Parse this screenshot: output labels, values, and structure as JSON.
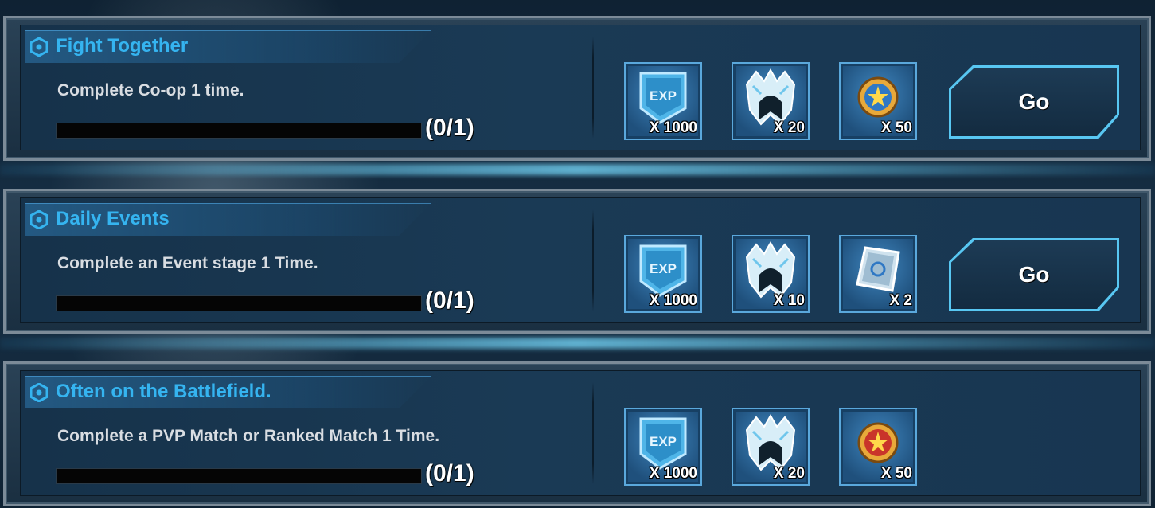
{
  "missions": [
    {
      "title": "Fight Together",
      "description": "Complete Co-op 1 time.",
      "progress_text": "(0/1)",
      "progress_fraction": 0,
      "rewards": [
        {
          "icon": "exp-card-icon",
          "qty": "X 1000"
        },
        {
          "icon": "helmet-icon",
          "qty": "X 20"
        },
        {
          "icon": "gold-medal-icon",
          "qty": "X 50"
        }
      ],
      "button": "Go"
    },
    {
      "title": "Daily Events",
      "description": "Complete an Event stage 1 Time.",
      "progress_text": "(0/1)",
      "progress_fraction": 0,
      "rewards": [
        {
          "icon": "exp-card-icon",
          "qty": "X 1000"
        },
        {
          "icon": "helmet-icon",
          "qty": "X 10"
        },
        {
          "icon": "crystal-chip-icon",
          "qty": "X 2"
        }
      ],
      "button": "Go"
    },
    {
      "title": "Often on the Battlefield.",
      "description": "Complete a PVP Match or Ranked Match 1 Time.",
      "progress_text": "(0/1)",
      "progress_fraction": 0,
      "rewards": [
        {
          "icon": "exp-card-icon",
          "qty": "X 1000"
        },
        {
          "icon": "helmet-icon",
          "qty": "X 20"
        },
        {
          "icon": "red-medal-icon",
          "qty": "X 50"
        }
      ]
    }
  ],
  "colors": {
    "title": "#35b4f0",
    "button_border": "#58c7f2",
    "progress_fill": "#3fb3ec"
  }
}
